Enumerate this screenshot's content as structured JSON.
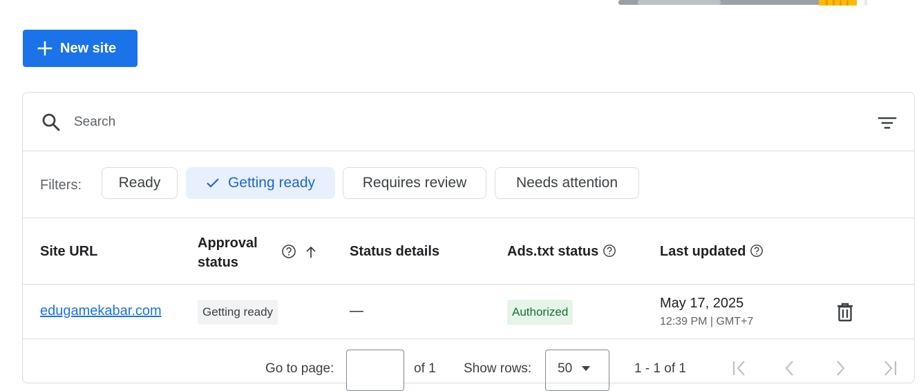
{
  "header": {
    "new_site_label": "New site"
  },
  "table": {
    "search_placeholder": "Search",
    "filters_label": "Filters:",
    "filter_chips": [
      "Ready",
      "Getting ready",
      "Requires review",
      "Needs attention"
    ],
    "selected_filter": "Getting ready",
    "columns": {
      "site_url": "Site URL",
      "approval_status_line1": "Approval",
      "approval_status_line2": "status",
      "status_details": "Status details",
      "ads_txt_status": "Ads.txt status",
      "last_updated": "Last updated"
    },
    "sort": "Approval status ascending",
    "rows": [
      {
        "site_url": "edugamekabar.com",
        "approval_status": "Getting ready",
        "status_details": "—",
        "ads_txt_status": "Authorized",
        "last_updated_date": "May 17, 2025",
        "last_updated_time": "12:39 PM | GMT+7"
      }
    ]
  },
  "pagination": {
    "go_to_page_label": "Go to page:",
    "page_value": "",
    "of_pages": "of 1",
    "show_rows_label": "Show rows:",
    "rows_per_page": "50",
    "range": "1 - 1 of 1"
  },
  "icons": {
    "add": "plus-icon",
    "search": "search-icon",
    "filter": "filter-list-icon",
    "check": "check-icon",
    "help": "help-circle-icon",
    "sort": "arrow-up-icon",
    "delete": "trash-icon",
    "first_page": "first-page-icon",
    "prev_page": "chevron-left-icon",
    "next_page": "chevron-right-icon",
    "last_page": "last-page-icon"
  },
  "colors": {
    "primary": "#1a73e8",
    "chip_selected_bg": "#e8f0fe",
    "authorized_bg": "#e6f4ea",
    "authorized_text": "#137333",
    "neutral_badge_bg": "#f1f3f4",
    "border": "#dadce0"
  }
}
